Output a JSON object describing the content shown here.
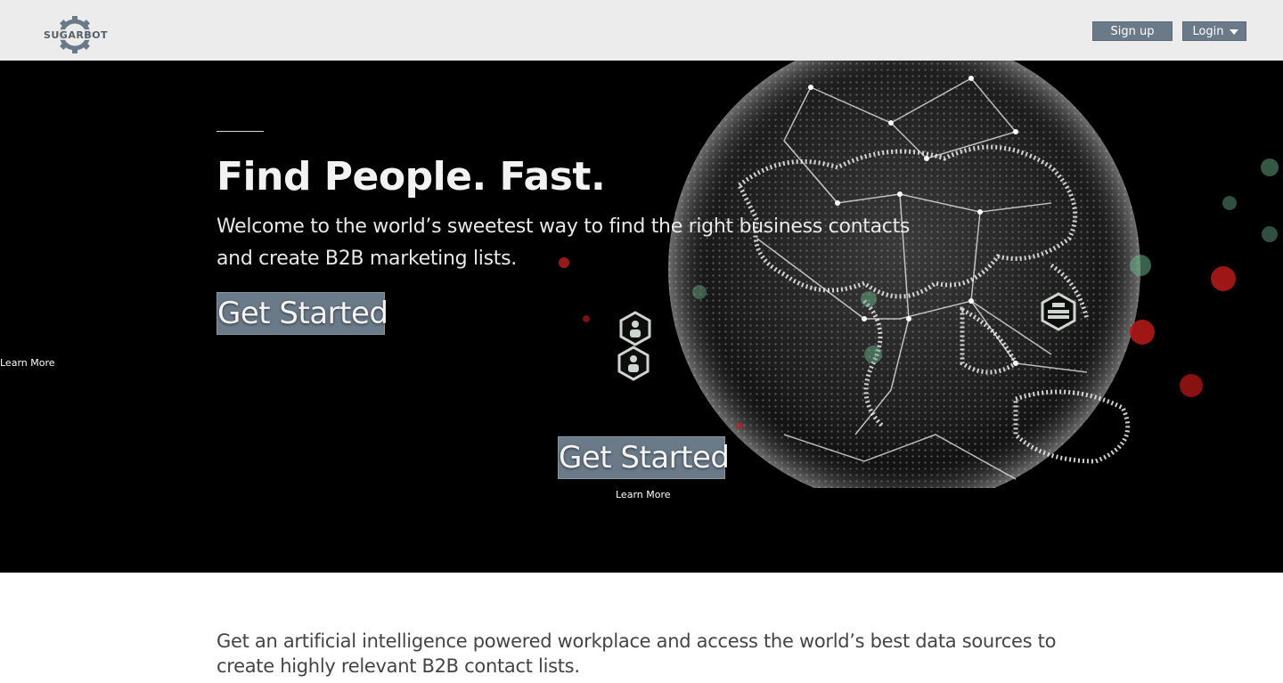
{
  "header": {
    "logo_text": "SUGARBOT",
    "signup_label": "Sign up",
    "login_label": "Login"
  },
  "hero": {
    "title": "Find People. Fast.",
    "subtitle": "Welcome to the world’s sweetest way to find the right business contacts and create B2B marketing lists.",
    "cta_primary": "Get Started",
    "cta_secondary": "Get Started",
    "learn_more_left": "Learn More",
    "learn_more_center": "Learn More"
  },
  "intro": {
    "text": "Get an artificial intelligence powered workplace and access the world’s best data sources to create highly relevant B2B contact lists."
  },
  "colors": {
    "header_bg": "#ececec",
    "button_bg": "#6b7a89",
    "hero_bg": "#000000",
    "body_text": "#444444"
  }
}
